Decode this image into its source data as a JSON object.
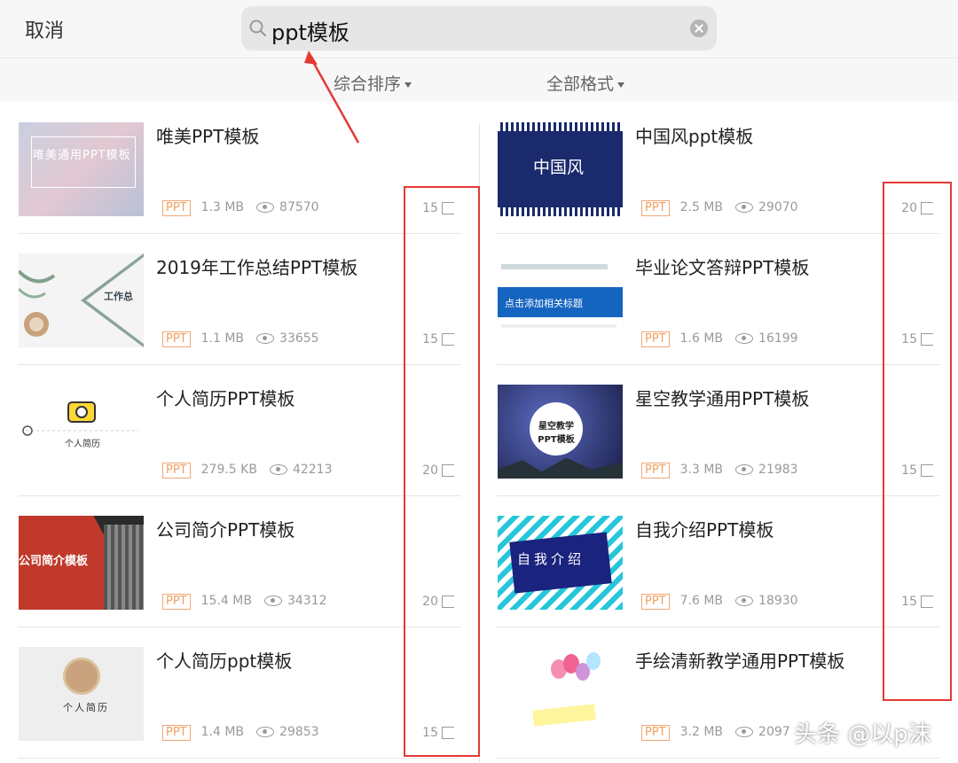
{
  "header": {
    "cancel_label": "取消",
    "search_query": "ppt模板"
  },
  "filters": {
    "sort_label": "综合排序",
    "format_label": "全部格式"
  },
  "results_left": [
    {
      "title": "唯美PPT模板",
      "tag": "PPT",
      "size": "1.3 MB",
      "views": "87570",
      "count": "15",
      "thumb_text": "唯美通用PPT模板"
    },
    {
      "title": "2019年工作总结PPT模板",
      "tag": "PPT",
      "size": "1.1 MB",
      "views": "33655",
      "count": "15",
      "thumb_text": "工作总"
    },
    {
      "title": "个人简历PPT模板",
      "tag": "PPT",
      "size": "279.5 KB",
      "views": "42213",
      "count": "20",
      "thumb_text": "个人简历"
    },
    {
      "title": "公司简介PPT模板",
      "tag": "PPT",
      "size": "15.4 MB",
      "views": "34312",
      "count": "20",
      "thumb_text": "公司简介模板"
    },
    {
      "title": "个人简历ppt模板",
      "tag": "PPT",
      "size": "1.4 MB",
      "views": "29853",
      "count": "15",
      "thumb_text": "个人简历"
    }
  ],
  "results_right": [
    {
      "title": "中国风ppt模板",
      "tag": "PPT",
      "size": "2.5 MB",
      "views": "29070",
      "count": "20",
      "thumb_text": "中国风"
    },
    {
      "title": "毕业论文答辩PPT模板",
      "tag": "PPT",
      "size": "1.6 MB",
      "views": "16199",
      "count": "15",
      "thumb_text": "点击添加相关标题"
    },
    {
      "title": "星空教学通用PPT模板",
      "tag": "PPT",
      "size": "3.3 MB",
      "views": "21983",
      "count": "15",
      "thumb_text": "星空教学PPT模板"
    },
    {
      "title": "自我介绍PPT模板",
      "tag": "PPT",
      "size": "7.6 MB",
      "views": "18930",
      "count": "15",
      "thumb_text": "自我介绍"
    },
    {
      "title": "手绘清新教学通用PPT模板",
      "tag": "PPT",
      "size": "3.2 MB",
      "views": "2097",
      "count": "",
      "thumb_text": ""
    }
  ],
  "watermark": "头条 @以p沫",
  "colors": {
    "annotation_red": "#e53935",
    "tag_orange": "#f0a060"
  }
}
